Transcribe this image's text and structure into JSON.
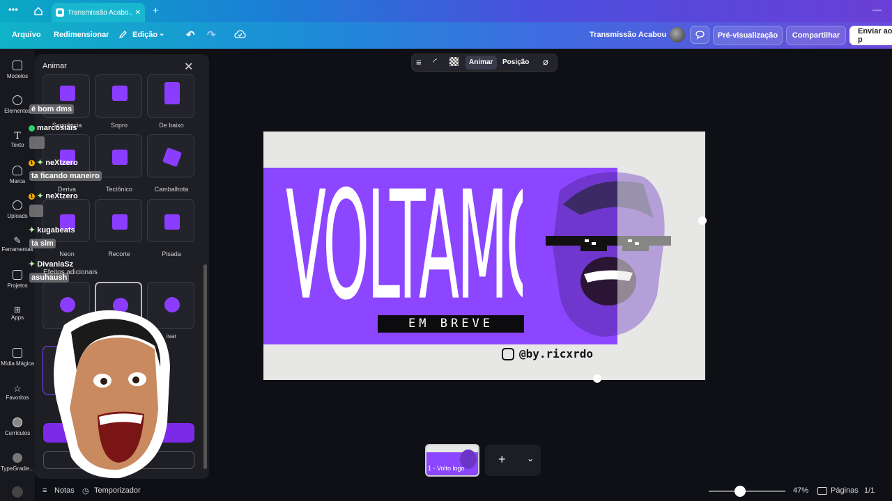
{
  "browser": {
    "tab_title": "Transmissão Acabo...",
    "menu_icon": "dots-icon",
    "home_icon": "home-icon"
  },
  "menubar": {
    "arquivo": "Arquivo",
    "redimensionar": "Redimensionar",
    "edicao": "Edição",
    "doc_title": "Transmissão Acabou",
    "preview": "Pré-visualização",
    "share": "Compartilhar",
    "send": "Enviar ao p"
  },
  "sidebar": {
    "items": [
      {
        "label": "Modelos"
      },
      {
        "label": "Elementos"
      },
      {
        "label": "Texto"
      },
      {
        "label": "Marca"
      },
      {
        "label": "Uploads"
      },
      {
        "label": "Ferramentas"
      },
      {
        "label": "Projetos"
      },
      {
        "label": "Apps"
      },
      {
        "label": "Mídia Mágica"
      },
      {
        "label": "Favoritos"
      },
      {
        "label": "Currículos"
      },
      {
        "label": "TypeGradie..."
      }
    ]
  },
  "panel": {
    "title": "Animar",
    "animations": [
      {
        "label": "Sequência"
      },
      {
        "label": "Sopro"
      },
      {
        "label": "De baixo"
      },
      {
        "label": "Deriva"
      },
      {
        "label": "Tectônico"
      },
      {
        "label": "Cambalhota"
      },
      {
        "label": "Neon"
      },
      {
        "label": "Recorte"
      },
      {
        "label": "Pisada"
      }
    ],
    "section": "Efeitos adicionais",
    "partial_label": "isar",
    "bottom_button_partial": "R"
  },
  "chat": [
    {
      "text": "é bom dms"
    },
    {
      "user": "marcosiais"
    },
    {
      "user": "neXtzero",
      "badge": "1"
    },
    {
      "text": "ta ficando maneiro"
    },
    {
      "user": "neXtzero",
      "badge": "1"
    },
    {
      "user": "kugabeats"
    },
    {
      "text": "ta sim"
    },
    {
      "user": "DivaniaSz"
    },
    {
      "text": "asuhaush"
    }
  ],
  "canvas_toolbar": {
    "animar": "Animar",
    "posicao": "Posição"
  },
  "design": {
    "headline": "VOLTAMOS",
    "subheadline": "EM BREVE",
    "handle": "@by.ricxrdo",
    "accent": "#8c46ff"
  },
  "pages_strip": {
    "page_label": "1 - Volto logo"
  },
  "bottom": {
    "notes": "Notas",
    "timer": "Temporizador",
    "zoom": "47%",
    "pages": "Páginas",
    "page_count": "1/1"
  }
}
